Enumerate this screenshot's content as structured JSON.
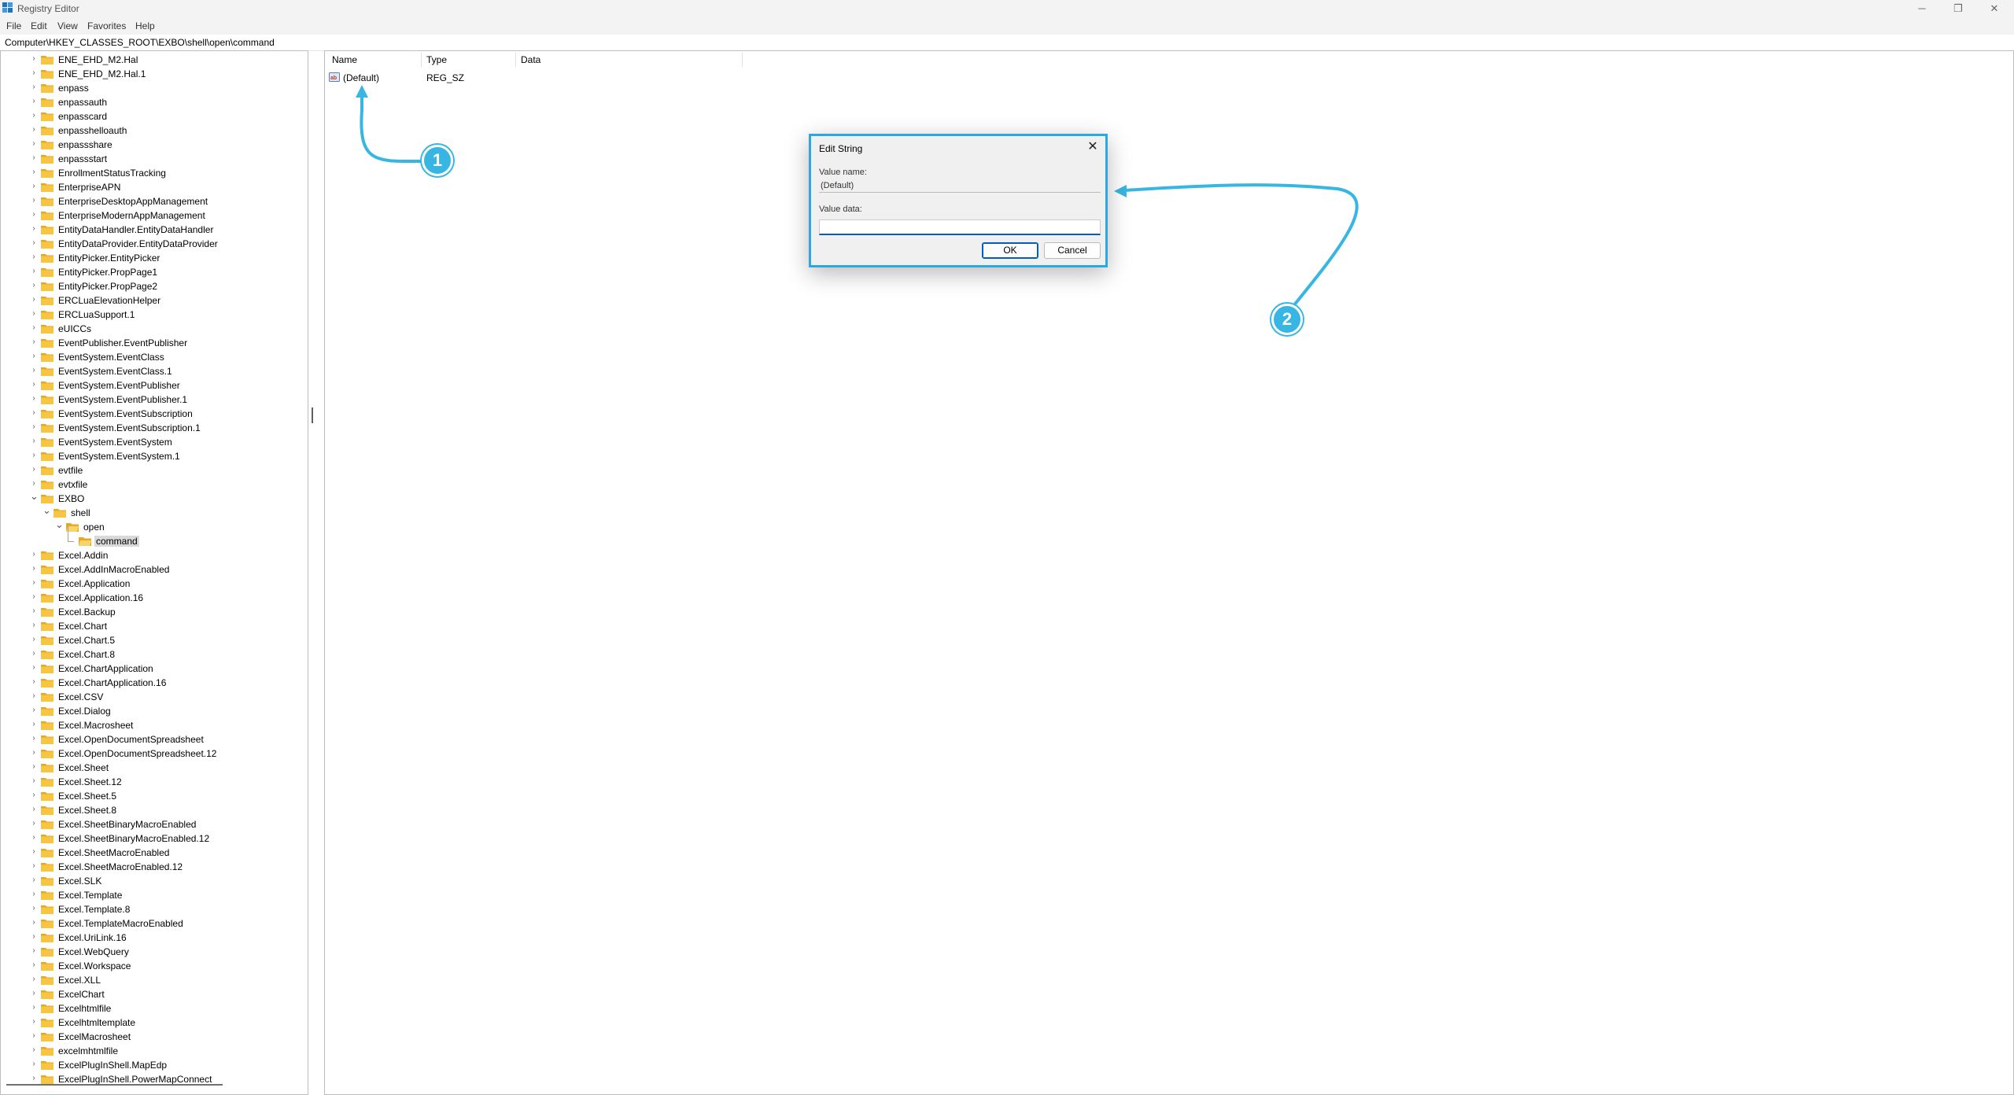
{
  "window": {
    "title": "Registry Editor",
    "controls": [
      "─",
      "❐",
      "✕"
    ]
  },
  "menu": [
    "File",
    "Edit",
    "View",
    "Favorites",
    "Help"
  ],
  "address": "Computer\\HKEY_CLASSES_ROOT\\EXBO\\shell\\open\\command",
  "tree": {
    "items": [
      "ENE_EHD_M2.Hal",
      "ENE_EHD_M2.Hal.1",
      "enpass",
      "enpassauth",
      "enpasscard",
      "enpasshelloauth",
      "enpassshare",
      "enpassstart",
      "EnrollmentStatusTracking",
      "EnterpriseAPN",
      "EnterpriseDesktopAppManagement",
      "EnterpriseModernAppManagement",
      "EntityDataHandler.EntityDataHandler",
      "EntityDataProvider.EntityDataProvider",
      "EntityPicker.EntityPicker",
      "EntityPicker.PropPage1",
      "EntityPicker.PropPage2",
      "ERCLuaElevationHelper",
      "ERCLuaSupport.1",
      "eUICCs",
      "EventPublisher.EventPublisher",
      "EventSystem.EventClass",
      "EventSystem.EventClass.1",
      "EventSystem.EventPublisher",
      "EventSystem.EventPublisher.1",
      "EventSystem.EventSubscription",
      "EventSystem.EventSubscription.1",
      "EventSystem.EventSystem",
      "EventSystem.EventSystem.1",
      "evtfile",
      "evtxfile",
      "EXBO",
      "shell",
      "open",
      "command",
      "Excel.Addin",
      "Excel.AddInMacroEnabled",
      "Excel.Application",
      "Excel.Application.16",
      "Excel.Backup",
      "Excel.Chart",
      "Excel.Chart.5",
      "Excel.Chart.8",
      "Excel.ChartApplication",
      "Excel.ChartApplication.16",
      "Excel.CSV",
      "Excel.Dialog",
      "Excel.Macrosheet",
      "Excel.OpenDocumentSpreadsheet",
      "Excel.OpenDocumentSpreadsheet.12",
      "Excel.Sheet",
      "Excel.Sheet.12",
      "Excel.Sheet.5",
      "Excel.Sheet.8",
      "Excel.SheetBinaryMacroEnabled",
      "Excel.SheetBinaryMacroEnabled.12",
      "Excel.SheetMacroEnabled",
      "Excel.SheetMacroEnabled.12",
      "Excel.SLK",
      "Excel.Template",
      "Excel.Template.8",
      "Excel.TemplateMacroEnabled",
      "Excel.UriLink.16",
      "Excel.WebQuery",
      "Excel.Workspace",
      "Excel.XLL",
      "ExcelChart",
      "Excelhtmlfile",
      "Excelhtmltemplate",
      "ExcelMacrosheet",
      "excelmhtmlfile",
      "ExcelPlugInShell.MapEdp",
      "ExcelPlugInShell.PowerMapConnect"
    ],
    "selected": "command"
  },
  "list": {
    "columns": [
      "Name",
      "Type",
      "Data"
    ],
    "rows": [
      {
        "name": "(Default)",
        "type": "REG_SZ",
        "data": ""
      }
    ]
  },
  "dialog": {
    "title": "Edit String",
    "value_name_label": "Value name:",
    "value_name": "(Default)",
    "value_data_label": "Value data:",
    "value_data": "",
    "ok": "OK",
    "cancel": "Cancel"
  },
  "annotations": [
    "1",
    "2"
  ],
  "colors": {
    "accent": "#38b6e3",
    "folder": "#f6c544",
    "dialog_border": "#2ea6df"
  }
}
